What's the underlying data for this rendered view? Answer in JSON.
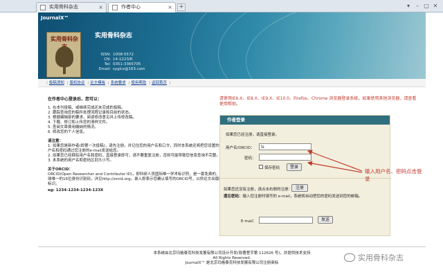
{
  "browser": {
    "tabs": [
      {
        "label": "实用骨科杂志"
      },
      {
        "label": "作者中心"
      }
    ],
    "new_tab": "+",
    "controls": [
      "▾",
      "–",
      "□",
      "✕"
    ]
  },
  "banner": {
    "brand": "JournalX™",
    "journal_title": "实用骨科杂志",
    "cover_title": "实用骨科杂志",
    "meta": [
      {
        "k": "ISSN:",
        "v": "1008-5572"
      },
      {
        "k": "CN:",
        "v": "14-1223/R"
      },
      {
        "k": "Tel:",
        "v": "0351-3365705"
      },
      {
        "k": "Email:",
        "v": "syglcz@163.com"
      }
    ]
  },
  "nav": [
    "投稿须知",
    "版权协议",
    "论文模板",
    "系统要求",
    "使用帮助",
    "返回首页"
  ],
  "welcome": {
    "heading": "在作者中心登录后，您可以：",
    "items": [
      "1. 在本刊投稿，或继续完成还未完成的投稿。",
      "2. 跟踪查询您的稿件处理流程记录和目前的状态。",
      "3. 根据编辑部的要求，阅读修改意见并上传修改稿。",
      "4. 下载、修订和上传您的清样文件。",
      "5. 查阅文章费用缴纳的情况。",
      "6. 修改您的个人信息。"
    ],
    "tip_head": "请注意：",
    "tips": [
      "1. 如果您是新作者(即第一次投稿)，请先注册，并记住您的用户名和口令，同时本系统还将把您设置的用户名和密码通过您注册的e-mail发送给您。",
      "2. 如果您已经拥有用户名和密码，直接登录即可，请不要重复注册，否则可能导致您信息查询不完整。",
      "3. 本系统的用户名和密码区别大小写。"
    ],
    "orcid_head": "关于ORCID：",
    "orcid_text": "ORCID(Open Researcher and Contributor ID)，即科研人员国际唯一学术标识符，是一套免费的、全球唯一的16位身份识别码，详见http://orcid.org。录入即表示您确认填写的ORCID号，以供论文出版时标识。",
    "orcid_eg": "eg: 1234-1234-1234-123X"
  },
  "browser_warning": "请使用IE6.X、IE8.X、IE9.X、IE10.0、Firefox、Chrome 浏览器登录系统。如果使用其他浏览器，请查看使用帮助。",
  "login": {
    "header": "作者登录",
    "intro": "如果您已经注册，请直接登录。",
    "username_label": "用户名/ORCID：",
    "username_value": "ls",
    "password_label": "密码：",
    "password_value": "",
    "remember_label": "保存密码",
    "login_button": "登录",
    "register_intro": "如果您还没有注册，请点击右侧的注册：",
    "register_button": "注册",
    "forgot_label": "遗忘密码：",
    "forgot_text": "输入您注册时填写的 e-mail，系统将自动把您的密码发送到您的邮箱。",
    "email_label": "E-mail：",
    "email_value": "",
    "send_button": "发送"
  },
  "annotation": "输入用户名、密码点击登录",
  "footer": {
    "line1": "本系统由北京玛格泰克科技发展有限公司设计开发(软著登字第 112626 号)，并提供技术支持",
    "line2": "All Rights Reserved.",
    "line3": "JournalX™ 是北京玛格泰克科技发展有限公司注册商标"
  },
  "watermark": "实用骨科杂志",
  "colors": {
    "banner_dark": "#0f4f73",
    "login_header": "#2f6f7f",
    "warning_red": "#c0392b",
    "link_blue": "#0a3d8f"
  }
}
